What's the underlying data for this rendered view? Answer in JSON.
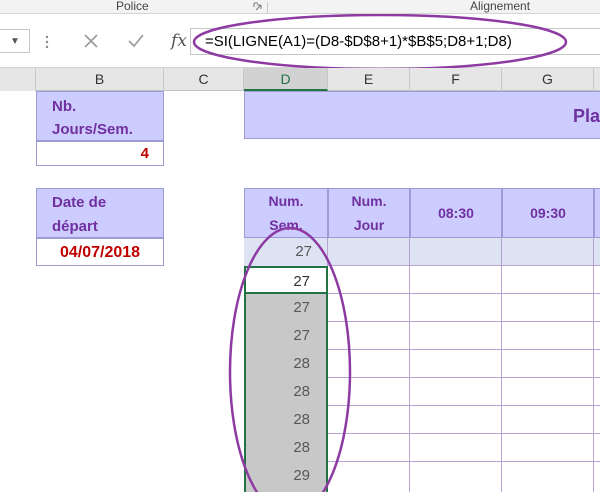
{
  "ribbon": {
    "group_police": "Police",
    "group_alignement": "Alignement"
  },
  "formula_bar": {
    "cancel_icon": "x-icon",
    "enter_icon": "check-icon",
    "function_label": "fx",
    "formula": "=SI(LIGNE(A1)=(D8-$D$8+1)*$B$5;D8+1;D8)"
  },
  "columns": {
    "b": "B",
    "c": "C",
    "d": "D",
    "e": "E",
    "f": "F",
    "g": "G"
  },
  "sheet": {
    "nb_jours_label_1": "Nb.",
    "nb_jours_label_2": "Jours/Sem.",
    "nb_jours_value": "4",
    "date_label_1": "Date de",
    "date_label_2": "départ",
    "date_value": "04/07/2018",
    "banner_fragment": "Pla",
    "header_num_sem_1": "Num.",
    "header_num_sem_2": "Sem.",
    "header_num_jour_1": "Num.",
    "header_num_jour_2": "Jour",
    "header_time_1": "08:30",
    "header_time_2": "09:30",
    "week_numbers": [
      "27",
      "27",
      "27",
      "27",
      "28",
      "28",
      "28",
      "28",
      "29"
    ]
  },
  "colors": {
    "header_fill": "#ccccff",
    "header_text": "#7030a0",
    "value_text": "#c00000",
    "annotation": "#8e3aa3",
    "selection": "#217346"
  }
}
